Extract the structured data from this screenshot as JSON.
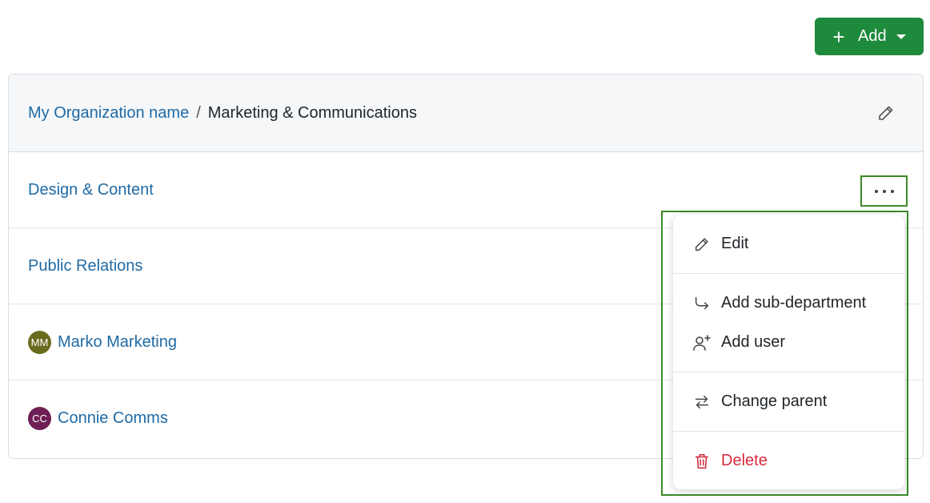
{
  "toolbar": {
    "add_label": "Add"
  },
  "breadcrumb": {
    "parent": "My Organization name",
    "separator": "/",
    "current": "Marketing & Communications"
  },
  "rows": [
    {
      "label": "Design & Content"
    },
    {
      "label": "Public Relations"
    },
    {
      "label": "Marko Marketing",
      "initials": "MM",
      "avatar_color": "#6b6b1f"
    },
    {
      "label": "Connie Comms",
      "initials": "CC",
      "avatar_color": "#6e1f55"
    }
  ],
  "menu": {
    "items": [
      {
        "label": "Edit",
        "icon": "pencil-icon"
      },
      {
        "label": "Add sub-department",
        "icon": "arrow-turn-right-icon"
      },
      {
        "label": "Add user",
        "icon": "user-plus-icon"
      },
      {
        "label": "Change parent",
        "icon": "swap-arrows-icon"
      },
      {
        "label": "Delete",
        "icon": "trash-icon"
      }
    ]
  },
  "colors": {
    "primary": "#1e8a3c",
    "link": "#1f6aa5",
    "danger": "#d42a3b",
    "highlight": "#3b8a2a"
  }
}
